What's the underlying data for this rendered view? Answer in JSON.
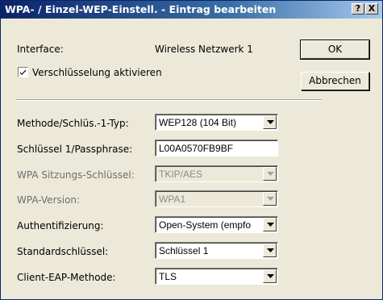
{
  "window": {
    "title": "WPA- / Einzel-WEP-Einstell. - Eintrag bearbeiten",
    "help_label": "?",
    "close_label": "X"
  },
  "buttons": {
    "ok": "OK",
    "cancel": "Abbrechen"
  },
  "interface": {
    "label": "Interface:",
    "value": "Wireless Netzwerk 1"
  },
  "encryption": {
    "label": "Verschlüsselung aktivieren",
    "checked": true
  },
  "fields": [
    {
      "label": "Methode/Schlüs.-1-Typ:",
      "value": "WEP128 (104 Bit)",
      "type": "dropdown",
      "enabled": true
    },
    {
      "label": "Schlüssel 1/Passphrase:",
      "value": "L00A0570FB9BF",
      "type": "text",
      "enabled": true
    },
    {
      "label": "WPA Sitzungs-Schlüssel:",
      "value": "TKIP/AES",
      "type": "dropdown",
      "enabled": false
    },
    {
      "label": "WPA-Version:",
      "value": "WPA1",
      "type": "dropdown",
      "enabled": false
    },
    {
      "label": "Authentifizierung:",
      "value": "Open-System (empfo",
      "type": "dropdown",
      "enabled": true
    },
    {
      "label": "Standardschlüssel:",
      "value": "Schlüssel 1",
      "type": "dropdown",
      "enabled": true
    },
    {
      "label": "Client-EAP-Methode:",
      "value": "TLS",
      "type": "dropdown",
      "enabled": true
    }
  ],
  "colors": {
    "titlebar_start": "#0a246a",
    "titlebar_end": "#a6caf0",
    "dialog_bg": "#ece9d8"
  }
}
